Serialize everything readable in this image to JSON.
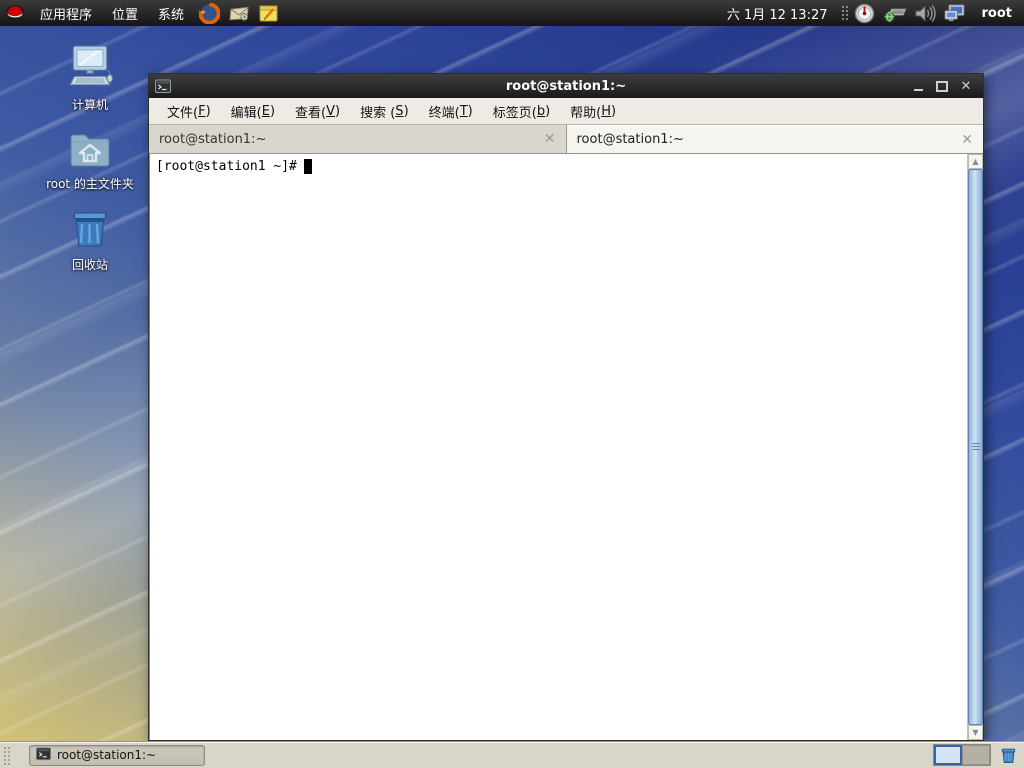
{
  "panel": {
    "menus": [
      {
        "label": "应用程序"
      },
      {
        "label": "位置"
      },
      {
        "label": "系统"
      }
    ],
    "clock": "六 1月 12 13:27",
    "user": "root"
  },
  "desktop": {
    "icons": [
      {
        "label": "计算机"
      },
      {
        "label": "root 的主文件夹"
      },
      {
        "label": "回收站"
      }
    ]
  },
  "window": {
    "title": "root@station1:~",
    "menu": [
      {
        "pre": "文件(",
        "key": "F",
        "post": ")"
      },
      {
        "pre": "编辑(",
        "key": "E",
        "post": ")"
      },
      {
        "pre": "查看(",
        "key": "V",
        "post": ")"
      },
      {
        "pre": "搜索 (",
        "key": "S",
        "post": ")"
      },
      {
        "pre": "终端(",
        "key": "T",
        "post": ")"
      },
      {
        "pre": "标签页(",
        "key": "b",
        "post": ")"
      },
      {
        "pre": "帮助(",
        "key": "H",
        "post": ")"
      }
    ],
    "tabs": [
      {
        "title": "root@station1:~"
      },
      {
        "title": "root@station1:~"
      }
    ],
    "terminal": {
      "prompt": "[root@station1 ~]#"
    }
  },
  "taskbar": {
    "task": "root@station1:~"
  },
  "icons": {
    "close": "✕",
    "tab_close": "✕",
    "scroll_up": "▲",
    "scroll_down": "▼"
  },
  "colors": {
    "desktop_top": "#203081",
    "desktop_bottom": "#d2c276",
    "panel_bg": "#1e1e1e",
    "titlebar_bg": "#2a2a2a",
    "menubar_bg": "#eeebe4",
    "active_tab_bg": "#f5f4f1",
    "inactive_tab_bg": "#d9d6cd",
    "scrollbar_thumb": "#a9c6e4",
    "workspace_active_border": "#3465a4",
    "workspace_active_fill": "#d3e4f6"
  }
}
